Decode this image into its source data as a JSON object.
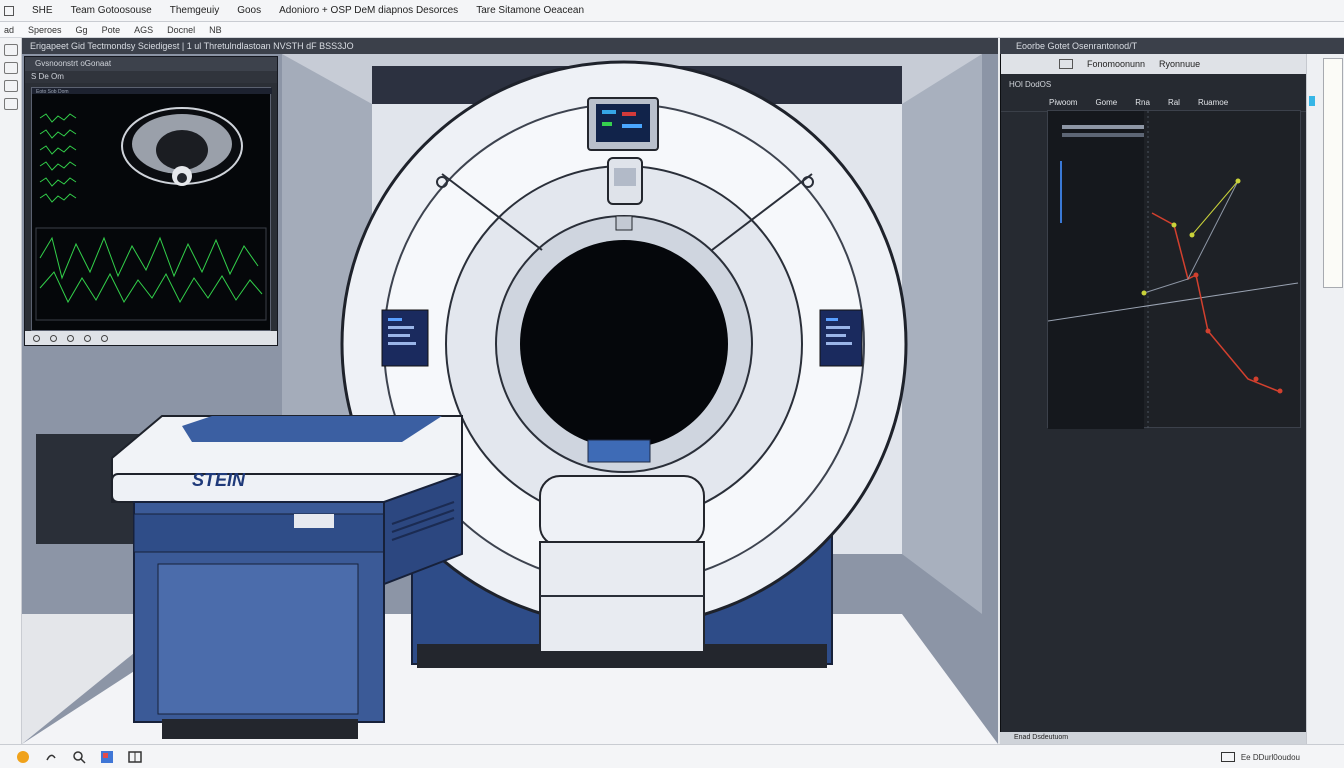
{
  "menubar": {
    "items": [
      "SHE",
      "Team Gotoosouse",
      "Themgeuiy",
      "Goos",
      "Adonioro + OSP DeM diapnos Desorces",
      "Tare Sitamone Oeacean"
    ]
  },
  "toolbar": {
    "items": [
      "ad",
      "Speroes",
      "Gg",
      "Pote",
      "AGS",
      "Docnel",
      "NB"
    ]
  },
  "viewport": {
    "title": "Erigapeet Gid Tectmondsy Sciedigest | 1 ul Thretulndlastoan NVSTH dF BSS3JO",
    "machine_brand": "STEIN"
  },
  "monitor_panel": {
    "header": "Gvsnoonstrt oGonaat",
    "tab": "S De Om",
    "top_label": "Eoto Sob Dom"
  },
  "right_panel": {
    "window_title": "Eoorbe Gotet Osenrantonod/T",
    "tabs": [
      "Fonomoonunn",
      "Ryonnuue"
    ],
    "row": [
      "HOl DodOS"
    ],
    "columns": [
      "Piwoom",
      "Gome",
      "Rna",
      "Ral",
      "Ruamoe"
    ],
    "footer": "Enad Dsdeutuom"
  },
  "taskbar": {
    "tray_label": "Ee DDurl0oudou"
  },
  "colors": {
    "panel_dark": "#262a31",
    "scan_green": "#32d04a",
    "graph_red": "#d2402e",
    "graph_yellow": "#c9d23a",
    "machine_blue": "#3b5a97",
    "machine_white": "#eef1f6"
  }
}
